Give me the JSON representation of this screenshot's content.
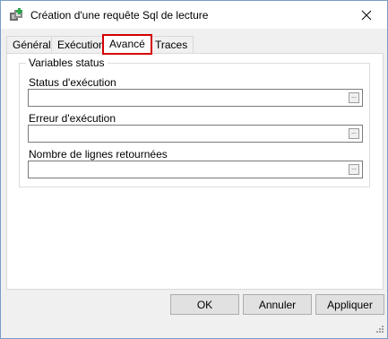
{
  "window": {
    "title": "Création d'une requête Sql de lecture"
  },
  "tabs": [
    {
      "label": "Général",
      "active": false
    },
    {
      "label": "Exécution",
      "active": false
    },
    {
      "label": "Avancé",
      "active": true
    },
    {
      "label": "Traces",
      "active": false
    }
  ],
  "group": {
    "title": "Variables status",
    "fields": [
      {
        "label": "Status d'exécution",
        "value": "",
        "button": "..."
      },
      {
        "label": "Erreur d'exécution",
        "value": "",
        "button": "..."
      },
      {
        "label": "Nombre de lignes retournées",
        "value": "",
        "button": "..."
      }
    ]
  },
  "buttons": {
    "ok": "OK",
    "cancel": "Annuler",
    "apply": "Appliquer"
  },
  "colors": {
    "active_tab_highlight": "#d40000",
    "app_icon_accent": "#2fa64b"
  }
}
